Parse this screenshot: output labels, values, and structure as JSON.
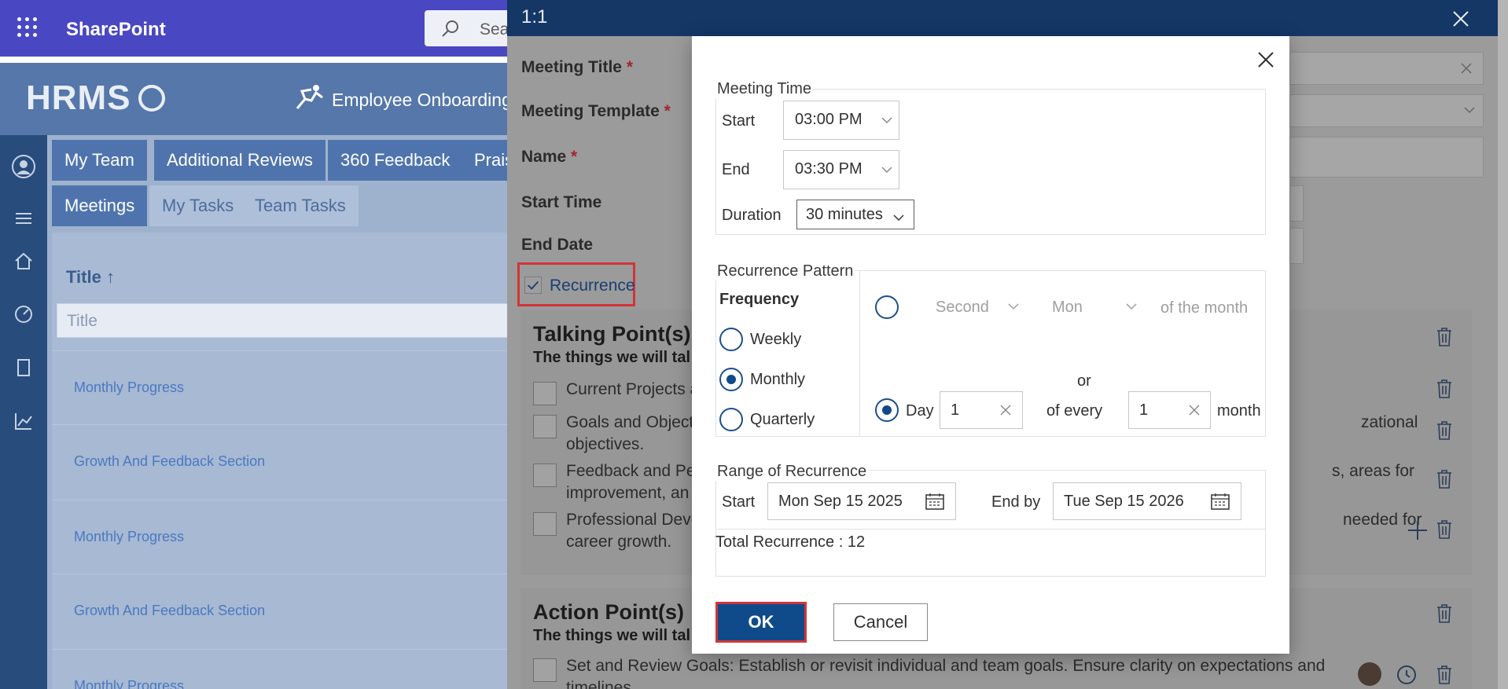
{
  "app": {
    "name": "SharePoint",
    "search_placeholder": "Sea",
    "brand": "HRMS",
    "section": "Employee Onboarding"
  },
  "tabs_row1": [
    "My Team",
    "Additional Reviews",
    "360 Feedback",
    "Praise"
  ],
  "tabs_row2": [
    "Meetings",
    "My Tasks",
    "Team Tasks"
  ],
  "grid": {
    "column": "Title ↑",
    "filter_placeholder": "Title",
    "rows": [
      "Monthly Progress",
      "Growth And Feedback Section",
      "Monthly Progress",
      "Growth And Feedback Section",
      "Monthly Progress"
    ]
  },
  "panel": {
    "title": "1:1",
    "labels": {
      "meeting_title": "Meeting Title",
      "meeting_template": "Meeting Template",
      "name": "Name",
      "start_time": "Start Time",
      "end_date": "End Date",
      "required": "*"
    },
    "recurrence_label": "Recurrence",
    "talking": {
      "heading": "Talking Point(s)",
      "subheading": "The things we will tal",
      "items": [
        {
          "line1": "Current Projects a",
          "line2": ""
        },
        {
          "line1": "Goals and Object",
          "tail1": "zational",
          "line2": "objectives."
        },
        {
          "line1": "Feedback and Per",
          "tail1": "s, areas for",
          "line2": "improvement, an"
        },
        {
          "line1": "Professional Deve",
          "tail1": "needed for",
          "line2": "career growth."
        }
      ]
    },
    "action": {
      "heading": "Action Point(s)",
      "subheading": "The things we will tal",
      "item_line1": "Set and Review Goals: Establish or revisit individual and team goals. Ensure clarity on expectations and",
      "item_line2": "timelines."
    }
  },
  "dialog": {
    "meeting_time": {
      "legend": "Meeting Time",
      "start_label": "Start",
      "start_value": "03:00 PM",
      "end_label": "End",
      "end_value": "03:30 PM",
      "duration_label": "Duration",
      "duration_value": "30 minutes"
    },
    "pattern": {
      "legend": "Recurrence Pattern",
      "frequency_label": "Frequency",
      "options": [
        "Weekly",
        "Monthly",
        "Quarterly"
      ],
      "selected": "Monthly",
      "ordinal": "Second",
      "weekday": "Mon",
      "of_month": "of the month",
      "or": "or",
      "day_label": "Day",
      "day_value": "1",
      "of_every": "of every",
      "every_value": "1",
      "month_label": "month"
    },
    "range": {
      "legend": "Range of Recurrence",
      "start_label": "Start",
      "start_value": "Mon Sep 15 2025",
      "end_label": "End by",
      "end_value": "Tue Sep 15 2026",
      "total": "Total Recurrence : 12"
    },
    "ok": "OK",
    "cancel": "Cancel"
  },
  "colors": {
    "suite_bar": "#4a47c2",
    "panel_header": "#143766",
    "primary": "#0f4a8a",
    "highlight": "#d13438"
  }
}
